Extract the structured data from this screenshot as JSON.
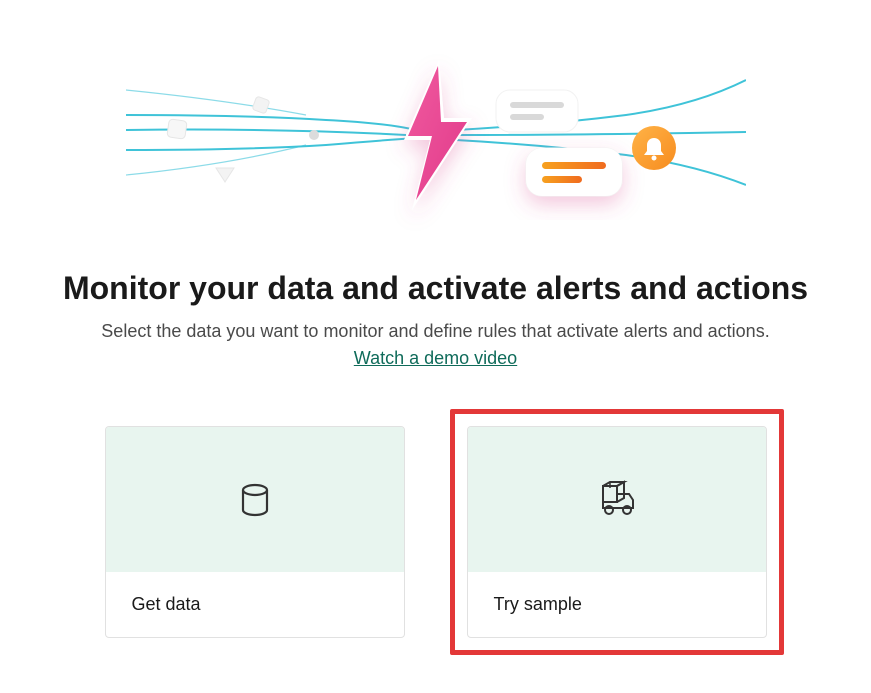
{
  "heading": "Monitor your data and activate alerts and actions",
  "subheading": "Select the data you want to monitor and define rules that activate alerts and actions.",
  "demo_link_label": "Watch a demo video",
  "cards": {
    "get_data": {
      "label": "Get data",
      "icon": "database-icon"
    },
    "try_sample": {
      "label": "Try sample",
      "icon": "delivery-truck-icon"
    }
  },
  "illustration": {
    "icons": [
      "lightning-icon",
      "bell-icon",
      "chat-lines-icon"
    ]
  }
}
